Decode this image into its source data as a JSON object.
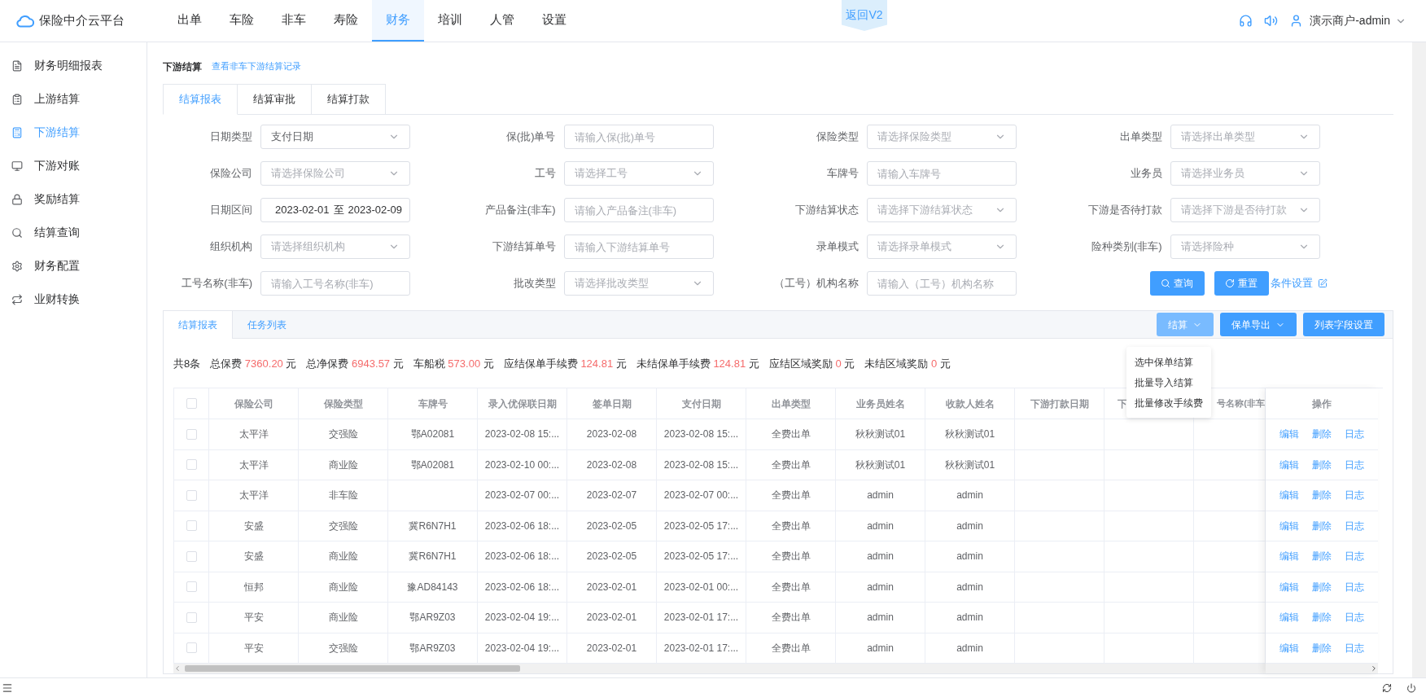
{
  "header": {
    "logo": "保险中介云平台",
    "nav": [
      {
        "label": "出单",
        "selected": false
      },
      {
        "label": "车险",
        "selected": false
      },
      {
        "label": "非车",
        "selected": false
      },
      {
        "label": "寿险",
        "selected": false
      },
      {
        "label": "财务",
        "selected": true
      },
      {
        "label": "培训",
        "selected": false
      },
      {
        "label": "人管",
        "selected": false
      },
      {
        "label": "设置",
        "selected": false
      }
    ],
    "badge": "返回V2",
    "user": "演示商户-admin"
  },
  "sidebar": {
    "items": [
      {
        "label": "财务明细报表",
        "selected": false
      },
      {
        "label": "上游结算",
        "selected": false
      },
      {
        "label": "下游结算",
        "selected": true
      },
      {
        "label": "下游对账",
        "selected": false
      },
      {
        "label": "奖励结算",
        "selected": false
      },
      {
        "label": "结算查询",
        "selected": false
      },
      {
        "label": "财务配置",
        "selected": false
      },
      {
        "label": "业财转换",
        "selected": false
      }
    ]
  },
  "breadcrumb": {
    "title": "下游结算",
    "link": "查看非车下游结算记录"
  },
  "tabs": [
    {
      "label": "结算报表",
      "selected": true
    },
    {
      "label": "结算审批",
      "selected": false
    },
    {
      "label": "结算打款",
      "selected": false
    }
  ],
  "filters": [
    {
      "label": "日期类型",
      "kind": "select",
      "value": "支付日期"
    },
    {
      "label": "保(批)单号",
      "kind": "input",
      "placeholder": "请输入保(批)单号"
    },
    {
      "label": "保险类型",
      "kind": "select",
      "placeholder": "请选择保险类型"
    },
    {
      "label": "出单类型",
      "kind": "select",
      "placeholder": "请选择出单类型"
    },
    {
      "label": "保险公司",
      "kind": "select",
      "placeholder": "请选择保险公司"
    },
    {
      "label": "工号",
      "kind": "select",
      "placeholder": "请选择工号"
    },
    {
      "label": "车牌号",
      "kind": "input",
      "placeholder": "请输入车牌号"
    },
    {
      "label": "业务员",
      "kind": "select",
      "placeholder": "请选择业务员"
    },
    {
      "label": "日期区间",
      "kind": "daterange",
      "start": "2023-02-01",
      "separator": "至",
      "end": "2023-02-09"
    },
    {
      "label": "产品备注(非车)",
      "kind": "input",
      "placeholder": "请输入产品备注(非车)"
    },
    {
      "label": "下游结算状态",
      "kind": "select",
      "placeholder": "请选择下游结算状态"
    },
    {
      "label": "下游是否待打款",
      "kind": "select",
      "placeholder": "请选择下游是否待打款"
    },
    {
      "label": "组织机构",
      "kind": "select",
      "placeholder": "请选择组织机构"
    },
    {
      "label": "下游结算单号",
      "kind": "input",
      "placeholder": "请输入下游结算单号"
    },
    {
      "label": "录单模式",
      "kind": "select",
      "placeholder": "请选择录单模式"
    },
    {
      "label": "险种类别(非车)",
      "kind": "select",
      "placeholder": "请选择险种"
    },
    {
      "label": "工号名称(非车)",
      "kind": "input",
      "placeholder": "请输入工号名称(非车)"
    },
    {
      "label": "批改类型",
      "kind": "select",
      "placeholder": "请选择批改类型"
    },
    {
      "label": "（工号）机构名称",
      "kind": "input",
      "placeholder": "请输入（工号）机构名称"
    }
  ],
  "filter_actions": {
    "search": "查询",
    "reset": "重置",
    "settings": "条件设置"
  },
  "panel": {
    "tabs": [
      {
        "label": "结算报表",
        "selected": true
      },
      {
        "label": "任务列表",
        "selected": false
      }
    ],
    "buttons": [
      {
        "label": "结算",
        "dropdown": true,
        "expanded": true
      },
      {
        "label": "保单导出",
        "dropdown": true,
        "expanded": false
      },
      {
        "label": "列表字段设置",
        "dropdown": false,
        "expanded": false
      }
    ],
    "menu": [
      "选中保单结算",
      "批量导入结算",
      "批量修改手续费"
    ]
  },
  "summary": {
    "count": "共8条",
    "items": [
      {
        "label": "总保费",
        "value": "7360.20",
        "unit": "元"
      },
      {
        "label": "总净保费",
        "value": "6943.57",
        "unit": "元"
      },
      {
        "label": "车船税",
        "value": "573.00",
        "unit": "元"
      },
      {
        "label": "应结保单手续费",
        "value": "124.81",
        "unit": "元"
      },
      {
        "label": "未结保单手续费",
        "value": "124.81",
        "unit": "元"
      },
      {
        "label": "应结区域奖励",
        "value": "0",
        "unit": "元"
      },
      {
        "label": "未结区域奖励",
        "value": "0",
        "unit": "元"
      }
    ]
  },
  "table": {
    "select_all_checked": false,
    "columns": [
      "保险公司",
      "保险类型",
      "车牌号",
      "录入优保联日期",
      "签单日期",
      "支付日期",
      "出单类型",
      "业务员姓名",
      "收款人姓名",
      "下游打款日期",
      "下",
      "号名称(非车"
    ],
    "action_column": "操作",
    "rows": [
      {
        "checked": false,
        "cells": [
          "太平洋",
          "交强险",
          "鄂A02081",
          "2023-02-08 15:...",
          "2023-02-08",
          "2023-02-08 15:...",
          "全费出单",
          "秋秋测试01",
          "秋秋测试01"
        ],
        "actions": [
          "编辑",
          "删除",
          "日志"
        ]
      },
      {
        "checked": false,
        "cells": [
          "太平洋",
          "商业险",
          "鄂A02081",
          "2023-02-10 00:...",
          "2023-02-08",
          "2023-02-08 15:...",
          "全费出单",
          "秋秋测试01",
          "秋秋测试01"
        ],
        "actions": [
          "编辑",
          "删除",
          "日志"
        ]
      },
      {
        "checked": false,
        "cells": [
          "太平洋",
          "非车险",
          "",
          "2023-02-07 00:...",
          "2023-02-07",
          "2023-02-07 00:...",
          "全费出单",
          "admin",
          "admin"
        ],
        "actions": [
          "编辑",
          "删除",
          "日志"
        ]
      },
      {
        "checked": false,
        "cells": [
          "安盛",
          "交强险",
          "冀R6N7H1",
          "2023-02-06 18:...",
          "2023-02-05",
          "2023-02-05 17:...",
          "全费出单",
          "admin",
          "admin"
        ],
        "actions": [
          "编辑",
          "删除",
          "日志"
        ]
      },
      {
        "checked": false,
        "cells": [
          "安盛",
          "商业险",
          "冀R6N7H1",
          "2023-02-06 18:...",
          "2023-02-05",
          "2023-02-05 17:...",
          "全费出单",
          "admin",
          "admin"
        ],
        "actions": [
          "编辑",
          "删除",
          "日志"
        ]
      },
      {
        "checked": false,
        "cells": [
          "恒邦",
          "商业险",
          "豫AD84143",
          "2023-02-06 18:...",
          "2023-02-01",
          "2023-02-01 00:...",
          "全费出单",
          "admin",
          "admin"
        ],
        "actions": [
          "编辑",
          "删除",
          "日志"
        ]
      },
      {
        "checked": false,
        "cells": [
          "平安",
          "商业险",
          "鄂AR9Z03",
          "2023-02-04 19:...",
          "2023-02-01",
          "2023-02-01 17:...",
          "全费出单",
          "admin",
          "admin"
        ],
        "actions": [
          "编辑",
          "删除",
          "日志"
        ]
      },
      {
        "checked": false,
        "cells": [
          "平安",
          "交强险",
          "鄂AR9Z03",
          "2023-02-04 19:...",
          "2023-02-01",
          "2023-02-01 17:...",
          "全费出单",
          "admin",
          "admin"
        ],
        "actions": [
          "编辑",
          "删除",
          "日志"
        ]
      }
    ]
  }
}
